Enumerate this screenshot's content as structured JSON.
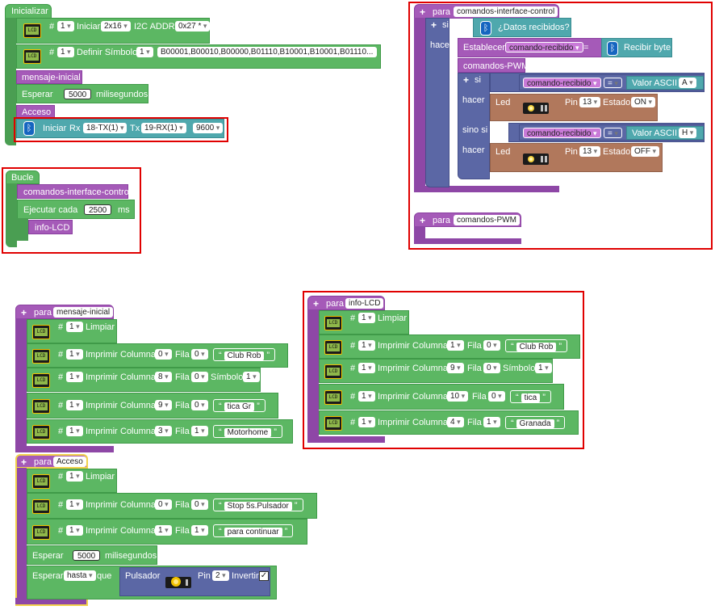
{
  "inicializar": {
    "hat": "Inicializar",
    "lcd1": {
      "hash": "#",
      "num": "1",
      "iniciar": "Iniciar",
      "size": "2x16",
      "i2c": "I2C ADDR",
      "addr": "0x27 *"
    },
    "lcd2": {
      "hash": "#",
      "num": "1",
      "definir": "Definir Símbolo",
      "symnum": "1",
      "pattern": "B00001,B00010,B00000,B01110,B10001,B10001,B01110..."
    },
    "call_mensaje": "mensaje-inicial",
    "esperar": {
      "label": "Esperar",
      "value": "5000",
      "unit": "milisegundos"
    },
    "call_acceso": "Acceso",
    "bt": {
      "iniciar": "Iniciar",
      "rx": "Rx",
      "rx_val": "18-TX(1)",
      "tx": "Tx",
      "tx_val": "19-RX(1)",
      "baud": "9600"
    }
  },
  "bucle": {
    "hat": "Bucle",
    "call": "comandos-interface-control",
    "ejecutar": {
      "label": "Ejecutar cada",
      "value": "2500",
      "unit": "ms"
    },
    "info": "info-LCD"
  },
  "interface": {
    "para": "para",
    "name": "comandos-interface-control",
    "si": "si",
    "datos": "¿Datos recibidos?",
    "hacer": "hacer",
    "establecer": "Establecer",
    "var": "comando-recibido",
    "eq": "=",
    "recibir": "Recibir byte",
    "call_pwm": "comandos-PWM",
    "if1": {
      "si": "si",
      "var": "comando-recibido",
      "op": "=",
      "ascii": "Valor ASCII",
      "letter": "A"
    },
    "led1": {
      "hacer": "hacer",
      "led": "Led",
      "pin": "Pin",
      "pin_val": "13",
      "estado": "Estado",
      "state": "ON"
    },
    "if2": {
      "sino": "sino si",
      "var": "comando-recibido",
      "op": "=",
      "ascii": "Valor ASCII",
      "letter": "H"
    },
    "led2": {
      "hacer": "hacer",
      "led": "Led",
      "pin": "Pin",
      "pin_val": "13",
      "estado": "Estado",
      "state": "OFF"
    }
  },
  "pwm": {
    "para": "para",
    "name": "comandos-PWM"
  },
  "mensaje": {
    "para": "para",
    "name": "mensaje-inicial",
    "limpiar": {
      "hash": "#",
      "num": "1",
      "label": "Limpiar"
    },
    "rows": [
      {
        "hash": "#",
        "num": "1",
        "imprimir": "Imprimir",
        "col": "Columna",
        "col_val": "0",
        "fila": "Fila",
        "fila_val": "0",
        "text": "Club Rob"
      },
      {
        "hash": "#",
        "num": "1",
        "imprimir": "Imprimir",
        "col": "Columna",
        "col_val": "8",
        "fila": "Fila",
        "fila_val": "0",
        "simbolo": "Símbolo",
        "sym_val": "1"
      },
      {
        "hash": "#",
        "num": "1",
        "imprimir": "Imprimir",
        "col": "Columna",
        "col_val": "9",
        "fila": "Fila",
        "fila_val": "0",
        "text": "tica Gr"
      },
      {
        "hash": "#",
        "num": "1",
        "imprimir": "Imprimir",
        "col": "Columna",
        "col_val": "3",
        "fila": "Fila",
        "fila_val": "1",
        "text": "Motorhome"
      }
    ]
  },
  "infolcd": {
    "para": "para",
    "name": "info-LCD",
    "limpiar": {
      "hash": "#",
      "num": "1",
      "label": "Limpiar"
    },
    "rows": [
      {
        "hash": "#",
        "num": "1",
        "imprimir": "Imprimir",
        "col": "Columna",
        "col_val": "1",
        "fila": "Fila",
        "fila_val": "0",
        "text": "Club Rob"
      },
      {
        "hash": "#",
        "num": "1",
        "imprimir": "Imprimir",
        "col": "Columna",
        "col_val": "9",
        "fila": "Fila",
        "fila_val": "0",
        "simbolo": "Símbolo",
        "sym_val": "1"
      },
      {
        "hash": "#",
        "num": "1",
        "imprimir": "Imprimir",
        "col": "Columna",
        "col_val": "10",
        "fila": "Fila",
        "fila_val": "0",
        "text": "tica"
      },
      {
        "hash": "#",
        "num": "1",
        "imprimir": "Imprimir",
        "col": "Columna",
        "col_val": "4",
        "fila": "Fila",
        "fila_val": "1",
        "text": "Granada"
      }
    ]
  },
  "acceso": {
    "para": "para",
    "name": "Acceso",
    "limpiar": {
      "hash": "#",
      "num": "1",
      "label": "Limpiar"
    },
    "rows": [
      {
        "hash": "#",
        "num": "1",
        "imprimir": "Imprimir",
        "col": "Columna",
        "col_val": "0",
        "fila": "Fila",
        "fila_val": "0",
        "text": "Stop 5s.Pulsador"
      },
      {
        "hash": "#",
        "num": "1",
        "imprimir": "Imprimir",
        "col": "Columna",
        "col_val": "1",
        "fila": "Fila",
        "fila_val": "1",
        "text": "para continuar"
      }
    ],
    "esperar": {
      "label": "Esperar",
      "value": "5000",
      "unit": "milisegundos"
    },
    "esperar_hasta": {
      "label": "Esperar",
      "mode": "hasta",
      "que": "que",
      "pulsador": "Pulsador",
      "pin": "Pin",
      "pin_val": "2",
      "invertir": "Invertir",
      "check": "✓"
    }
  },
  "lcd_icon_text": "LCD",
  "colors": {
    "green": "#5cb763",
    "purple": "#a55ab8",
    "teal": "#4fa8ad",
    "blue": "#5b67a5",
    "brown": "#b1785c",
    "highlight": "#e00000"
  }
}
